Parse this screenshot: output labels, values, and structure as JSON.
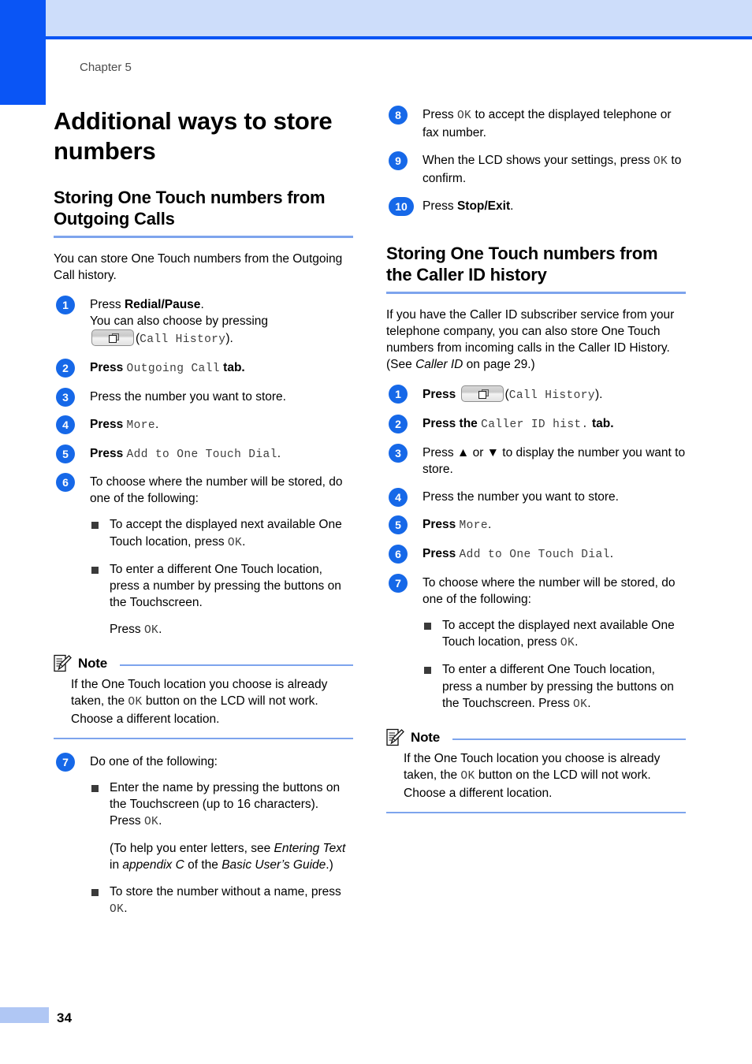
{
  "page": {
    "chapter_label": "Chapter 5",
    "page_number": "34",
    "accent_blue": "#0a55f5",
    "rule_blue": "#7da4ed",
    "header_band_blue": "#cdddfa",
    "badge_blue": "#1668e8"
  },
  "title": "Additional ways to store numbers",
  "left_column": {
    "section_heading": "Storing One Touch numbers from Outgoing Calls",
    "intro": "You can store One Touch numbers from the Outgoing Call history.",
    "steps": [
      {
        "number": "1",
        "line1_pre": "Press ",
        "line1_bold": "Redial/Pause",
        "line1_post": ".",
        "line2": "You can also choose by pressing",
        "button_icon": "call-history-icon",
        "line3_lcd": "Call History",
        "line3_open": "(",
        "line3_close": ")."
      },
      {
        "number": "2",
        "pre": "Press ",
        "lcd": "Outgoing Call",
        "post_bold": " tab."
      },
      {
        "number": "3",
        "text": "Press the number you want to store."
      },
      {
        "number": "4",
        "pre": "Press ",
        "lcd": "More",
        "post": "."
      },
      {
        "number": "5",
        "pre": "Press ",
        "lcd": "Add to One Touch Dial",
        "post": "."
      },
      {
        "number": "6",
        "text": "To choose where the number will be stored, do one of the following:",
        "bullets": [
          {
            "pre": "To accept the displayed next available One Touch location, press ",
            "lcd": "OK",
            "post": "."
          },
          {
            "pre": "To enter a different One Touch location, press a number by pressing the buttons on the Touchscreen.",
            "sub_pre": "Press ",
            "sub_lcd": "OK",
            "sub_post": "."
          }
        ]
      }
    ],
    "note": {
      "label": "Note",
      "icon": "note-pencil-icon",
      "text_pre": "If the One Touch location you choose is already taken, the ",
      "text_lcd": "OK",
      "text_post": " button on the LCD will not work. Choose a different location."
    },
    "steps_after_note": [
      {
        "number": "7",
        "text": "Do one of the following:",
        "bullets": [
          {
            "pre": "Enter the name by pressing the buttons on the Touchscreen (up to 16 characters).",
            "line_break_pre": "Press ",
            "line_break_lcd": "OK",
            "line_break_post": ".",
            "para_pre": "(To help you enter letters, see ",
            "para_italic1": "Entering Text",
            "para_mid1": " in ",
            "para_italic2": "appendix C",
            "para_mid2": " of the ",
            "para_italic3": "Basic User’s Guide",
            "para_post": ".)"
          },
          {
            "pre": "To store the number without a name, press ",
            "lcd": "OK",
            "post": "."
          }
        ]
      }
    ]
  },
  "right_column": {
    "steps_top": [
      {
        "number": "8",
        "pre": "Press ",
        "lcd": "OK",
        "post": " to accept the displayed telephone or fax number."
      },
      {
        "number": "9",
        "pre": "When the LCD shows your settings, press ",
        "lcd": "OK",
        "post": " to confirm."
      },
      {
        "number": "10",
        "pre": "Press ",
        "bold": "Stop/Exit",
        "post": "."
      }
    ],
    "section_heading": "Storing One Touch numbers from the Caller ID history",
    "intro_pre": "If you have the Caller ID subscriber service from your telephone company, you can also store One Touch numbers from incoming calls in the Caller ID History. (See ",
    "intro_italic": "Caller ID",
    "intro_post": " on page 29.)",
    "steps": [
      {
        "number": "1",
        "pre": "Press ",
        "button_icon": "call-history-icon",
        "open": "(",
        "lcd": "Call History",
        "close": ")."
      },
      {
        "number": "2",
        "pre": "Press the ",
        "lcd": "Caller ID hist.",
        "post_bold": " tab."
      },
      {
        "number": "3",
        "text": "Press ▲ or ▼ to display the number you want to store."
      },
      {
        "number": "4",
        "text": "Press the number you want to store."
      },
      {
        "number": "5",
        "pre": "Press ",
        "lcd": "More",
        "post": "."
      },
      {
        "number": "6",
        "pre": "Press ",
        "lcd": "Add to One Touch Dial",
        "post": "."
      },
      {
        "number": "7",
        "text": "To choose where the number will be stored, do one of the following:",
        "bullets": [
          {
            "pre": "To accept the displayed next available One Touch location, press ",
            "lcd": "OK",
            "post": "."
          },
          {
            "pre": "To enter a different One Touch location, press a number by pressing the buttons on the Touchscreen. Press ",
            "lcd": "OK",
            "post": "."
          }
        ]
      }
    ],
    "note": {
      "label": "Note",
      "icon": "note-pencil-icon",
      "text_pre": "If the One Touch location you choose is already taken, the ",
      "text_lcd": "OK",
      "text_post": " button on the LCD will not work. Choose a different location."
    }
  }
}
